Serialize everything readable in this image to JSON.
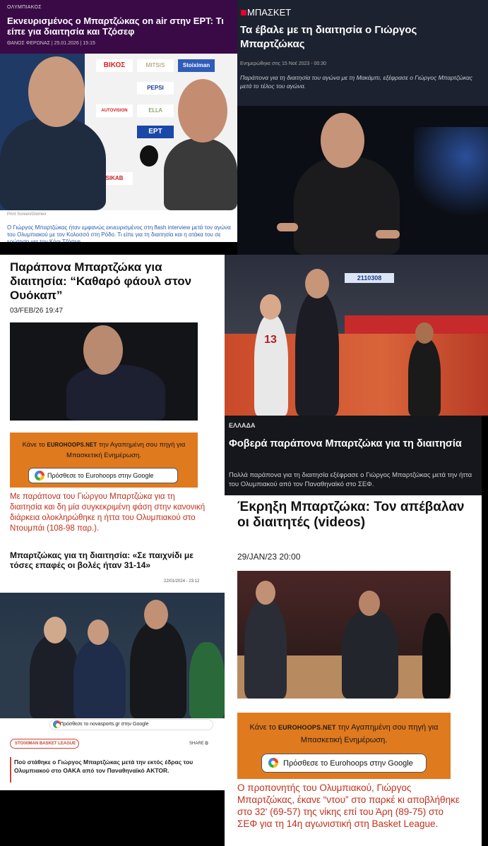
{
  "card1": {
    "category": "ΟΛΥΜΠΙΑΚΟΣ",
    "title": "Εκνευρισμένος ο Μπαρτζώκας on air στην ΕΡΤ: Τι είπε για διαιτησία και Τζόσεφ",
    "meta": "ΘΑΝΟΣ ΦΕΡΩΝΑΣ   |   25.01.2026   |   15:15",
    "credit": "Print Screen/Glomex",
    "caption": "Ο Γιώργος Μπαρτζώκας ήταν εμφανώς εκνευρισμένος στη flash interview μετά τον αγώνα του Ολυμπιακού με τον Κολοσσό στη Ρόδο. Τι είπε για τη διαιτησία και η ατάκα του σε ερώτηση για τον Κόρι Τζόσεφ.",
    "sponsors": [
      "ΒΙΚΟΣ",
      "MITSIS",
      "Stoiximan",
      "PEPSI",
      "AUTOVISION",
      "ΕΡΤ",
      "ELLA",
      "SIKAB"
    ]
  },
  "card2": {
    "category": "ΜΠΑΣΚΕΤ",
    "title": "Τα έβαλε με τη διαιτησία ο Γιώργος Μπαρτζώκας",
    "meta": "Ενημερώθηκε στις 15 Νοέ 2023 - 00:30",
    "caption": "Παράπονα για τη διαιτησία του αγώνα με τη Μακάμπι, εξέφρασε ο Γιώργος Μπαρτζώκας μετά το τέλος του αγώνα."
  },
  "card3": {
    "title": "Παράπονα Μπαρτζώκα για διαιτησία: “Καθαρό φάουλ στον Ουόκαπ”",
    "date": "03/FEB/26 19:47",
    "promo_pre": "Κάνε το",
    "promo_brand": "EUROHOOPS.NET",
    "promo_post": "την Αγαπημένη σου πηγή για Μπασκετική Ενημέρωση.",
    "button": "Πρόσθεσε το Eurohoops στην Google",
    "body": "Με παράπονα του Γιώργου Μπαρτζώκα για τη διαιτησία και δη μία συγκεκριμένη φάση στην κανονική διάρκεια ολοκληρώθηκε η ήττα του Ολυμπιακού στο Ντουμπάι (108-98 παρ.)."
  },
  "card4": {
    "jersey_number": "13",
    "board_text": "2110308"
  },
  "card5": {
    "category": "ΕΛΛΑΔΑ",
    "title": "Φοβερά παράπονα Μπαρτζώκα για τη διαιτησία",
    "caption": "Πολλά παράπονα για τη διαιτησία εξέφρασε ο Γιώργος Μπαρτζώκας μετά την ήττα του Ολυμπιακού από τον Παναθηναϊκό στο ΣΕΦ."
  },
  "card6": {
    "title": "Έκρηξη Μπαρτζώκα: Τον απέβαλαν οι διαιτητές (videos)",
    "date": "29/JAN/23 20:00",
    "promo_pre": "Κάνε το",
    "promo_brand": "EUROHOOPS.NET",
    "promo_post": "την Αγαπημένη σου πηγή για Μπασκετική Ενημέρωση.",
    "button": "Πρόσθεσε το Eurohoops στην Google",
    "body": "Ο προπονητής του Ολυμπιακού, Γιώργος Μπαρτζώκας, έκανε “ντου” στο παρκέ κι αποβλήθηκε στο 32' (69-57) της νίκης επί του Άρη (89-75) στο ΣΕΦ για τη 14η αγωνιστική στη Basket League."
  },
  "card7": {
    "title": "Μπαρτζώκας για τη διαιτησία: «Σε παιχνίδι με τόσες επαφές οι βολές ήταν 31-14»",
    "date": "22/01/2024 - 23:12",
    "google_pill": "Πρόσθεσε το novasports.gr στην Google",
    "badge": "STOIXIMAN BASKET LEAGUE",
    "share": "SHARE",
    "body": "Πού στάθηκε ο Γιώργος Μπαρτζώκας μετά την εκτός έδρας του Ολυμπιακού στο ΟΑΚΑ από τον Παναθηναϊκό AKTOR."
  }
}
